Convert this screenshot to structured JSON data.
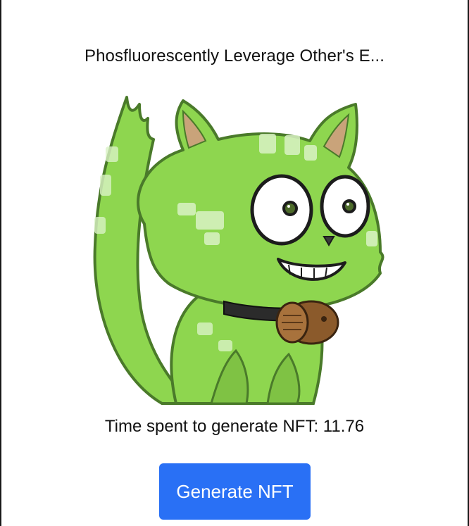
{
  "nft": {
    "title": "Phosfluorescently Leverage Other's E...",
    "image_subject": "green-cartoon-cat-icon"
  },
  "stats": {
    "time_label": "Time spent to generate NFT: 11.76"
  },
  "actions": {
    "generate_label": "Generate NFT"
  },
  "colors": {
    "button": "#2970f5",
    "cat_body": "#8ed64f",
    "cat_outline": "#4a7a2a",
    "cat_spots": "#d9f2c4",
    "collar": "#2b2b2b",
    "barrel": "#8b5a2b"
  }
}
